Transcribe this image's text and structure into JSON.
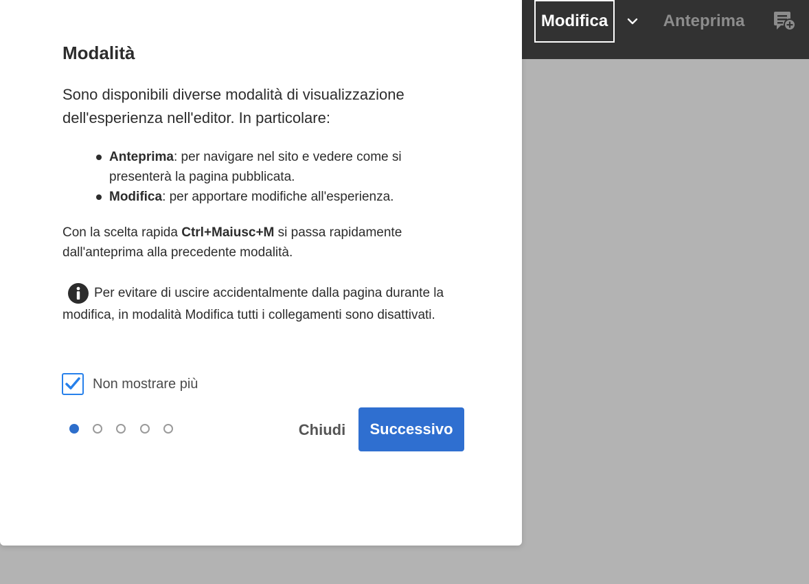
{
  "topbar": {
    "edit_label": "Modifica",
    "preview_label": "Anteprima",
    "dropdown_icon": "chevron-down-icon",
    "annotate_icon": "annotate-icon",
    "background_color": "#323232",
    "inactive_text_color": "#8c8c8c"
  },
  "dialog": {
    "title": "Modalità",
    "intro": "Sono disponibili diverse modalità di visualizzazione dell'esperienza nell'editor. In particolare:",
    "items": [
      {
        "term": "Anteprima",
        "description": ": per navigare nel sito e vedere come si presenterà la pagina pubblicata."
      },
      {
        "term": "Modifica",
        "description": ": per apportare modifiche all'esperienza."
      }
    ],
    "shortcut": {
      "prefix": "Con la scelta rapida ",
      "keys": "Ctrl+Maiusc+M",
      "suffix": " si passa rapidamente dall'anteprima alla precedente modalità."
    },
    "info": {
      "icon": "info-icon",
      "text": "Per evitare di uscire accidentalmente dalla pagina durante la modifica, in modalità Modifica tutti i collegamenti sono disattivati."
    },
    "checkbox": {
      "label": "Non mostrare più",
      "checked": true
    },
    "pagination": {
      "total": 5,
      "current": 1
    },
    "buttons": {
      "close_label": "Chiudi",
      "next_label": "Successivo"
    },
    "accent_color": "#2f6fd0"
  }
}
